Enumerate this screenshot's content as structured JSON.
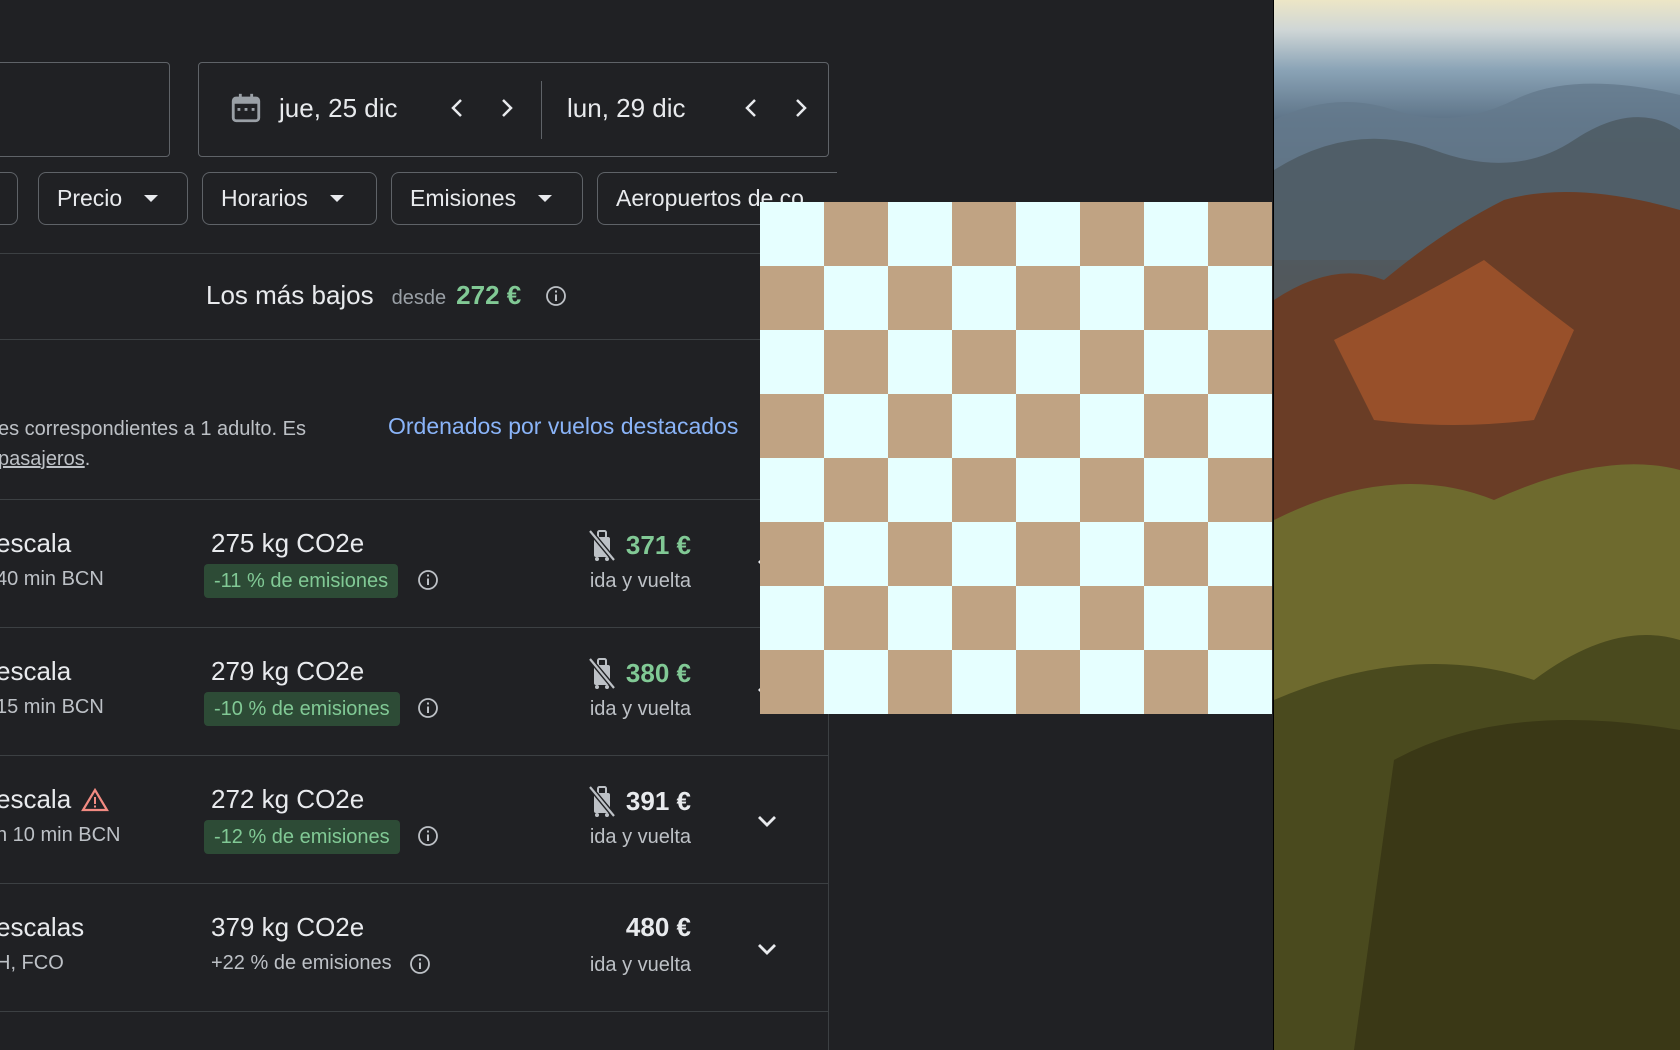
{
  "search": {
    "depart_date": "jue, 25 dic",
    "return_date": "lun, 29 dic"
  },
  "filters": [
    "Precio",
    "Horarios",
    "Emisiones",
    "Aeropuertos de co"
  ],
  "lowest": {
    "title": "Los más bajos",
    "from_label": "desde",
    "price": "272 €"
  },
  "notice": {
    "line1": "es correspondientes a 1 adulto. Es",
    "link": "pasajeros",
    "line2_suffix": "."
  },
  "sort_label": "Ordenados por vuelos destacados",
  "flights": [
    {
      "stops": "escala",
      "warning": false,
      "stop_info": "40 min BCN",
      "co2": "275 kg CO2e",
      "emissions": "-11 % de emisiones",
      "emissions_style": "badge",
      "no_bag": true,
      "price": "371 €",
      "price_color": "green",
      "trip": "ida y vuelta"
    },
    {
      "stops": "escala",
      "warning": false,
      "stop_info": "15 min BCN",
      "co2": "279 kg CO2e",
      "emissions": "-10 % de emisiones",
      "emissions_style": "badge",
      "no_bag": true,
      "price": "380 €",
      "price_color": "green",
      "trip": "ida y vuelta"
    },
    {
      "stops": "escala",
      "warning": true,
      "stop_info": "h 10 min BCN",
      "co2": "272 kg CO2e",
      "emissions": "-12 % de emisiones",
      "emissions_style": "badge",
      "no_bag": true,
      "price": "391 €",
      "price_color": "white",
      "trip": "ida y vuelta"
    },
    {
      "stops": "escalas",
      "warning": false,
      "stop_info": "H, FCO",
      "co2": "379 kg CO2e",
      "emissions": "+22 % de emisiones",
      "emissions_style": "plain",
      "no_bag": false,
      "price": "480 €",
      "price_color": "white",
      "trip": "ida y vuelta"
    }
  ],
  "colors": {
    "background": "#202124",
    "accent_green": "#81c995",
    "link_blue": "#8ab4f8",
    "badge_bg": "#2d4b36",
    "checker_a": "#e6ffff",
    "checker_b": "#c0a383"
  }
}
